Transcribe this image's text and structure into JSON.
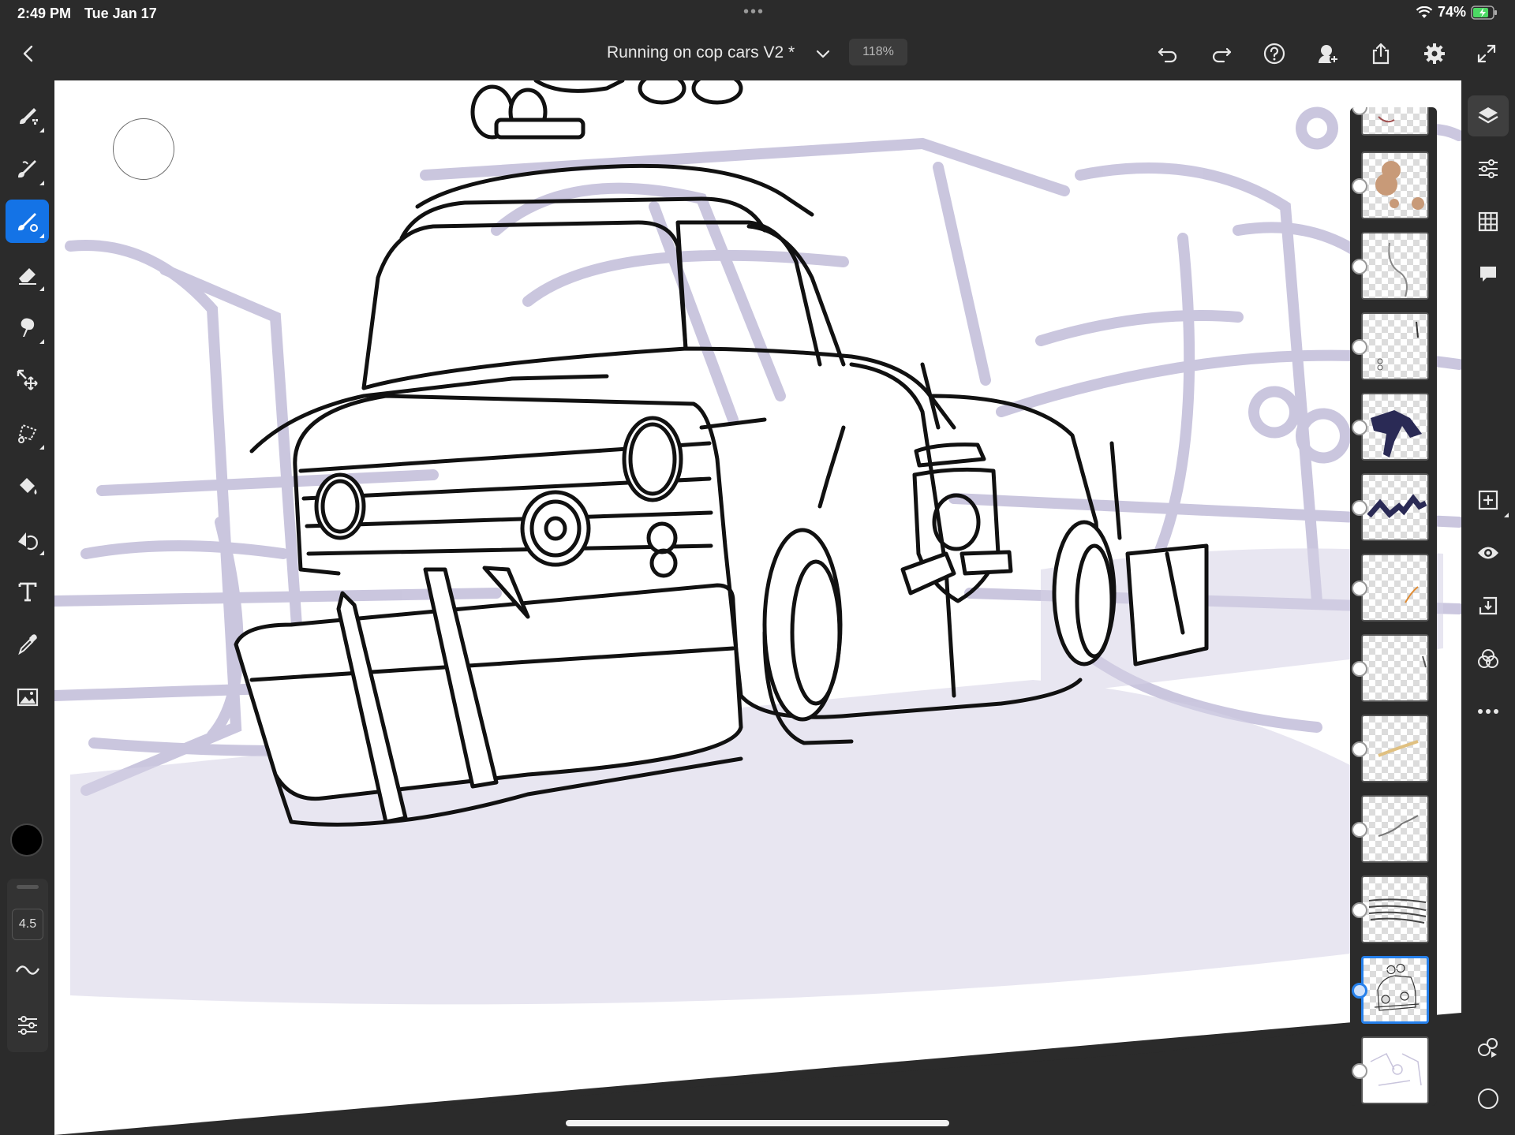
{
  "status": {
    "time": "2:49 PM",
    "date": "Tue Jan 17",
    "battery": "74%"
  },
  "header": {
    "doc_title": "Running on cop cars V2 *",
    "zoom": "118%"
  },
  "brush": {
    "size": "4.5",
    "color": "#000000"
  },
  "tools": [
    "pixel-brush",
    "live-brush",
    "vector-brush",
    "eraser",
    "smudge",
    "transform",
    "selection",
    "fill",
    "liquify",
    "text",
    "eyedropper",
    "image",
    "color"
  ],
  "right_tools": [
    "layers",
    "layer-properties",
    "grid",
    "comments",
    "add-layer",
    "visibility",
    "merge-down",
    "blend-mode",
    "more"
  ],
  "layers_count": 13,
  "selected_layer_index": 11,
  "accent_color": "#1473e6"
}
